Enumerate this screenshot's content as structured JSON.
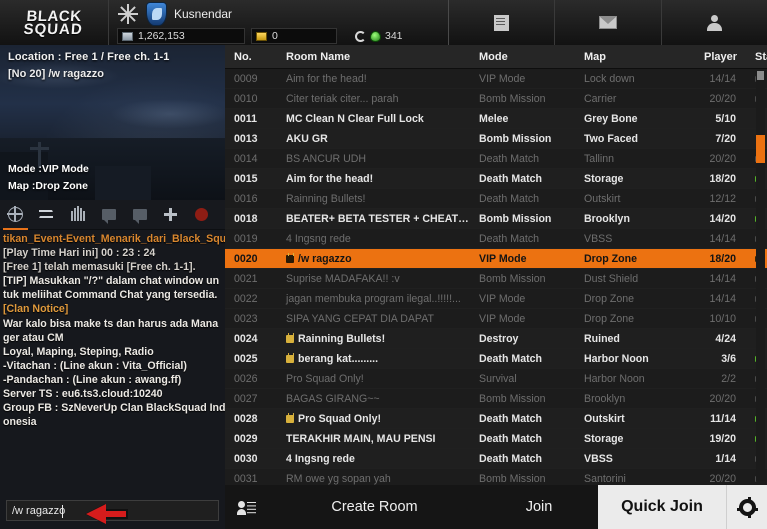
{
  "topbar": {
    "logo_line1": "BLACK",
    "logo_line2": "SQUAD",
    "username": "Kusnendar",
    "gp_value": "1,262,153",
    "coin_value": "0",
    "point_value": "341",
    "icons": [
      "news-icon",
      "mail-icon",
      "profile-icon"
    ]
  },
  "left_panel": {
    "location": "Location : Free 1 / Free ch. 1-1",
    "room_label": "[No 20]  /w ragazzo",
    "mode_label": "Mode :VIP Mode",
    "map_label": "Map :Drop Zone",
    "chat_tabs": [
      {
        "name": "globe-icon",
        "selected": true
      },
      {
        "name": "swap-icon",
        "selected": false
      },
      {
        "name": "clan-icon",
        "selected": false
      },
      {
        "name": "speech-bubble-icon",
        "selected": false
      },
      {
        "name": "speech-bubble-2-icon",
        "selected": false
      },
      {
        "name": "plus-icon",
        "selected": false
      },
      {
        "name": "record-dot-icon",
        "selected": false
      }
    ],
    "chat_lines": [
      {
        "text": "tikan_Event-Event_Menarik_dari_Black_Squad_In",
        "color": "orange"
      },
      {
        "text": "[Play Time Hari ini] 00 : 23 : 24",
        "color": "gray"
      },
      {
        "text": "[Free 1] telah memasuki [Free ch. 1-1].",
        "color": "gray"
      },
      {
        "text": "[TIP] Masukkan \"/?\" dalam chat window un",
        "color": "white"
      },
      {
        "text": "tuk meliihat Command Chat yang tersedia.",
        "color": "white"
      },
      {
        "text": "[Clan Notice]",
        "color": "orange2"
      },
      {
        "text": "War kalo bisa make ts dan harus ada Mana",
        "color": "white"
      },
      {
        "text": "ger atau CM",
        "color": "white"
      },
      {
        "text": "Loyal, Maping, Steping, Radio",
        "color": "white"
      },
      {
        "text": "-Vitachan      : (Line akun : Vita_Official)",
        "color": "white"
      },
      {
        "text": "-Pandachan : (Line akun : awang.ff)",
        "color": "white"
      },
      {
        "text": "Server TS : eu6.ts3.cloud:10240",
        "color": "white"
      },
      {
        "text": "Group FB  : SzNeverUp Clan BlackSquad Ind",
        "color": "white"
      },
      {
        "text": "onesia",
        "color": "white"
      }
    ],
    "chat_input_value": "/w ragazzo",
    "chat_input_placeholder": ""
  },
  "room_list": {
    "columns": [
      "No.",
      "Room Name",
      "Mode",
      "Map",
      "Player",
      "Status"
    ],
    "rows": [
      {
        "no": "0009",
        "name": "Aim for the head!",
        "locked": false,
        "mode": "VIP Mode",
        "map": "Lock down",
        "player": "14/14",
        "state": "dark",
        "play": false,
        "scale": true
      },
      {
        "no": "0010",
        "name": "Citer teriak citer... parah",
        "locked": false,
        "mode": "Bomb Mission",
        "map": "Carrier",
        "player": "20/20",
        "state": "dark",
        "play": false,
        "scale": false
      },
      {
        "no": "0011",
        "name": "MC Clean N Clear Full Lock",
        "locked": false,
        "mode": "Melee",
        "map": "Grey Bone",
        "player": "5/10",
        "state": "lite",
        "play": false,
        "scale": false
      },
      {
        "no": "0013",
        "name": "AKU GR",
        "locked": false,
        "mode": "Bomb Mission",
        "map": "Two Faced",
        "player": "7/20",
        "state": "lite",
        "play": false,
        "scale": false
      },
      {
        "no": "0014",
        "name": "BS ANCUR UDH",
        "locked": false,
        "mode": "Death Match",
        "map": "Tallinn",
        "player": "20/20",
        "state": "dark",
        "play": false,
        "scale": true
      },
      {
        "no": "0015",
        "name": "Aim for the head!",
        "locked": false,
        "mode": "Death Match",
        "map": "Storage",
        "player": "18/20",
        "state": "lite",
        "play": true,
        "scale": true,
        "scale_on": true
      },
      {
        "no": "0016",
        "name": "Rainning Bullets!",
        "locked": false,
        "mode": "Death Match",
        "map": "Outskirt",
        "player": "12/12",
        "state": "dark",
        "play": false,
        "scale": true
      },
      {
        "no": "0018",
        "name": "BEATER+ BETA TESTER + CHEATER",
        "locked": false,
        "mode": "Bomb Mission",
        "map": "Brooklyn",
        "player": "14/20",
        "state": "lite",
        "play": true,
        "scale": false
      },
      {
        "no": "0019",
        "name": "4 Ingsng rede",
        "locked": false,
        "mode": "Death Match",
        "map": "VBSS",
        "player": "14/14",
        "state": "dark",
        "play": false,
        "scale": true
      },
      {
        "no": "0020",
        "name": "/w ragazzo",
        "locked": true,
        "mode": "VIP Mode",
        "map": "Drop Zone",
        "player": "18/20",
        "state": "sel",
        "play": true,
        "scale": true
      },
      {
        "no": "0021",
        "name": "Suprise MADAFAKA!! :v",
        "locked": false,
        "mode": "Bomb Mission",
        "map": "Dust Shield",
        "player": "14/14",
        "state": "dark",
        "play": false,
        "scale": false
      },
      {
        "no": "0022",
        "name": "jagan membuka program ilegal..!!!!!...",
        "locked": false,
        "mode": "VIP Mode",
        "map": "Drop Zone",
        "player": "14/14",
        "state": "dark",
        "play": false,
        "scale": true
      },
      {
        "no": "0023",
        "name": "SIPA YANG CEPAT DIA DAPAT",
        "locked": false,
        "mode": "VIP Mode",
        "map": "Drop Zone",
        "player": "10/10",
        "state": "dark",
        "play": false,
        "scale": false
      },
      {
        "no": "0024",
        "name": "Rainning Bullets!",
        "locked": true,
        "mode": "Destroy",
        "map": "Ruined",
        "player": "4/24",
        "state": "lite",
        "play": false,
        "scale": false
      },
      {
        "no": "0025",
        "name": "berang kat.........",
        "locked": true,
        "mode": "Death Match",
        "map": "Harbor Noon",
        "player": "3/6",
        "state": "lite",
        "play": true,
        "scale": false
      },
      {
        "no": "0026",
        "name": "Pro Squad Only!",
        "locked": false,
        "mode": "Survival",
        "map": "Harbor Noon",
        "player": "2/2",
        "state": "dark",
        "play": false,
        "scale": false
      },
      {
        "no": "0027",
        "name": "BAGAS GIRANG~~",
        "locked": false,
        "mode": "Bomb Mission",
        "map": "Brooklyn",
        "player": "20/20",
        "state": "dark",
        "play": false,
        "scale": false
      },
      {
        "no": "0028",
        "name": "Pro Squad Only!",
        "locked": true,
        "mode": "Death Match",
        "map": "Outskirt",
        "player": "11/14",
        "state": "lite",
        "play": true,
        "scale": false
      },
      {
        "no": "0029",
        "name": "TERAKHIR MAIN, MAU PENSI",
        "locked": false,
        "mode": "Death Match",
        "map": "Storage",
        "player": "19/20",
        "state": "lite",
        "play": true,
        "scale": true,
        "scale_on": true
      },
      {
        "no": "0030",
        "name": "4 Ingsng rede",
        "locked": false,
        "mode": "Death Match",
        "map": "VBSS",
        "player": "1/14",
        "state": "lite",
        "play": false,
        "scale": true,
        "scale_on": true
      },
      {
        "no": "0031",
        "name": "RM owe yg sopan yah",
        "locked": false,
        "mode": "Bomb Mission",
        "map": "Santorini",
        "player": "20/20",
        "state": "dark",
        "play": false,
        "scale": false
      }
    ]
  },
  "bottom_bar": {
    "roster_icon": "roster-icon",
    "create_room": "Create Room",
    "join": "Join",
    "quick_join": "Quick Join",
    "settings_icon": "gear-icon"
  },
  "colors": {
    "accent": "#ec7211",
    "selected_row": "#ec7211",
    "quick_join_bg": "#ebebeb",
    "play_on": "#54b227",
    "scale_on": "#e0b020",
    "arrow": "#d61c1c"
  }
}
